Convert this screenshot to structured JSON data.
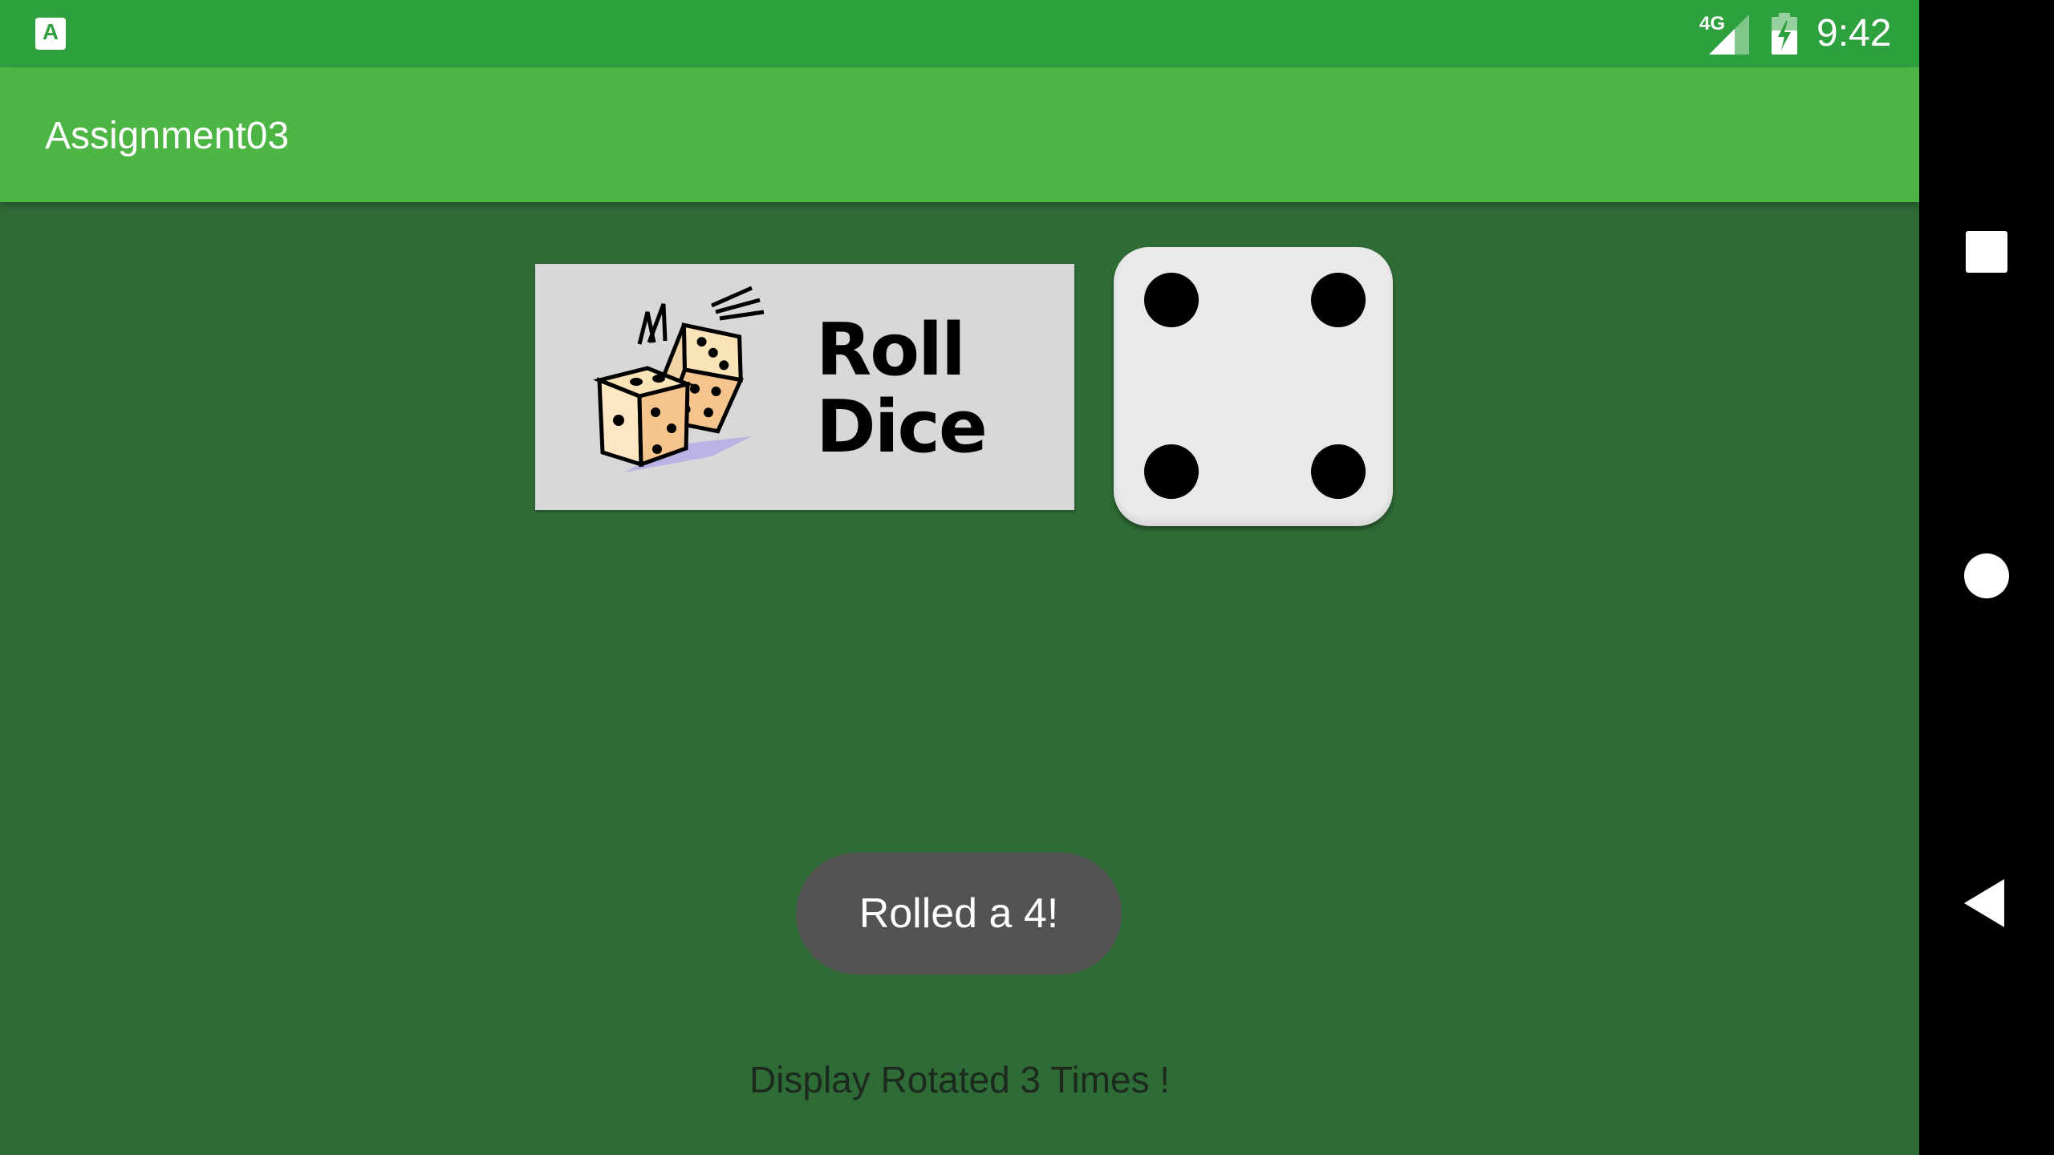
{
  "status_bar": {
    "network": "4G",
    "time": "9:42",
    "app_icon_letter": "A"
  },
  "app_bar": {
    "title": "Assignment03"
  },
  "main": {
    "roll_button_label": "Roll Dice",
    "die_value": 4,
    "toast_text": "Rolled a 4!",
    "rotation_text": "Display Rotated 3 Times !"
  },
  "colors": {
    "status_bar": "#2ea13f",
    "app_bar": "#4db544",
    "background": "#2f6b36",
    "toast": "#535353"
  },
  "nav_bar": {
    "icons": [
      "recents-icon",
      "home-icon",
      "back-icon"
    ]
  }
}
